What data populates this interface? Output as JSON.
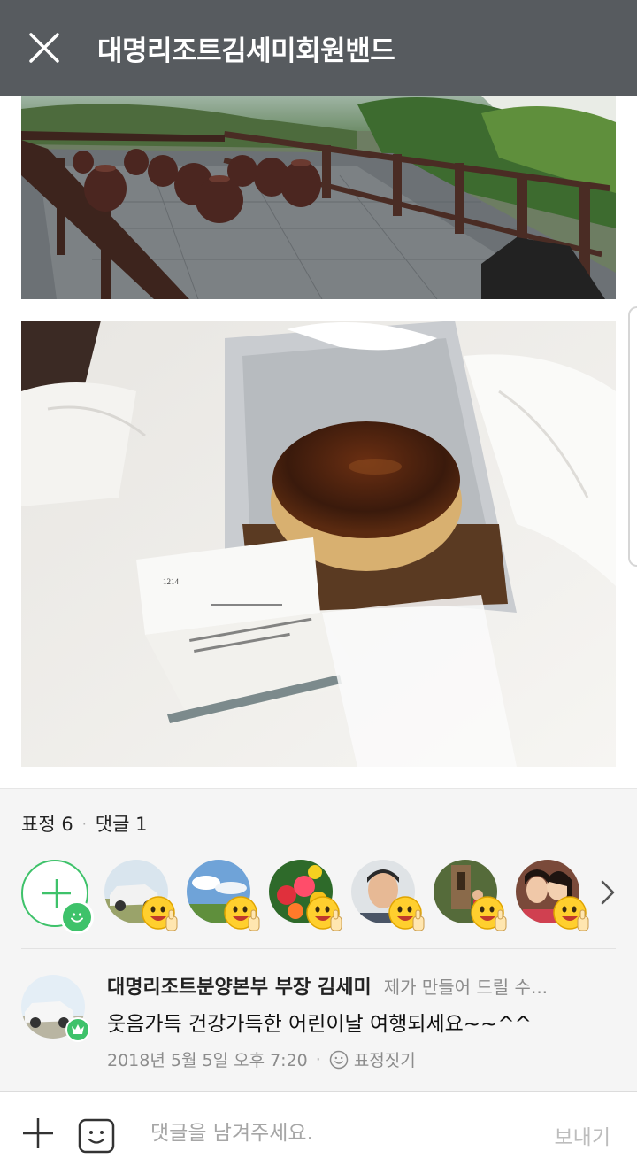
{
  "header": {
    "title": "대명리조트김세미회원밴드",
    "close_icon": "close-icon",
    "background": "#575b5f"
  },
  "photos": [
    {
      "icon": "photo-terrace-with-jars"
    },
    {
      "icon": "photo-cake-in-box-with-card"
    }
  ],
  "reactions": {
    "emotion_label": "표정 6",
    "comment_label": "댓글 1",
    "separator": "·",
    "accent": "#3ec26a",
    "reactors": [
      {
        "icon": "avatar-white-suv"
      },
      {
        "icon": "avatar-sky-landscape"
      },
      {
        "icon": "avatar-flowers"
      },
      {
        "icon": "avatar-man-portrait"
      },
      {
        "icon": "avatar-outdoor-group"
      },
      {
        "icon": "avatar-two-girls"
      }
    ],
    "reaction_emoji": "thumbs-up-smile-emoji"
  },
  "comment": {
    "author": "대명리조트분양본부 부장 김세미",
    "preview": "제가 만들어 드릴 수...",
    "text": "웃음가득 건강가득한 어린이날 여행되세요~~^^",
    "timestamp": "2018년 5월 5일 오후 7:20",
    "separator": "·",
    "react_label": "표정짓기",
    "author_badge": "crown-icon"
  },
  "input_bar": {
    "placeholder": "댓글을 남겨주세요.",
    "send_label": "보내기",
    "value": ""
  }
}
